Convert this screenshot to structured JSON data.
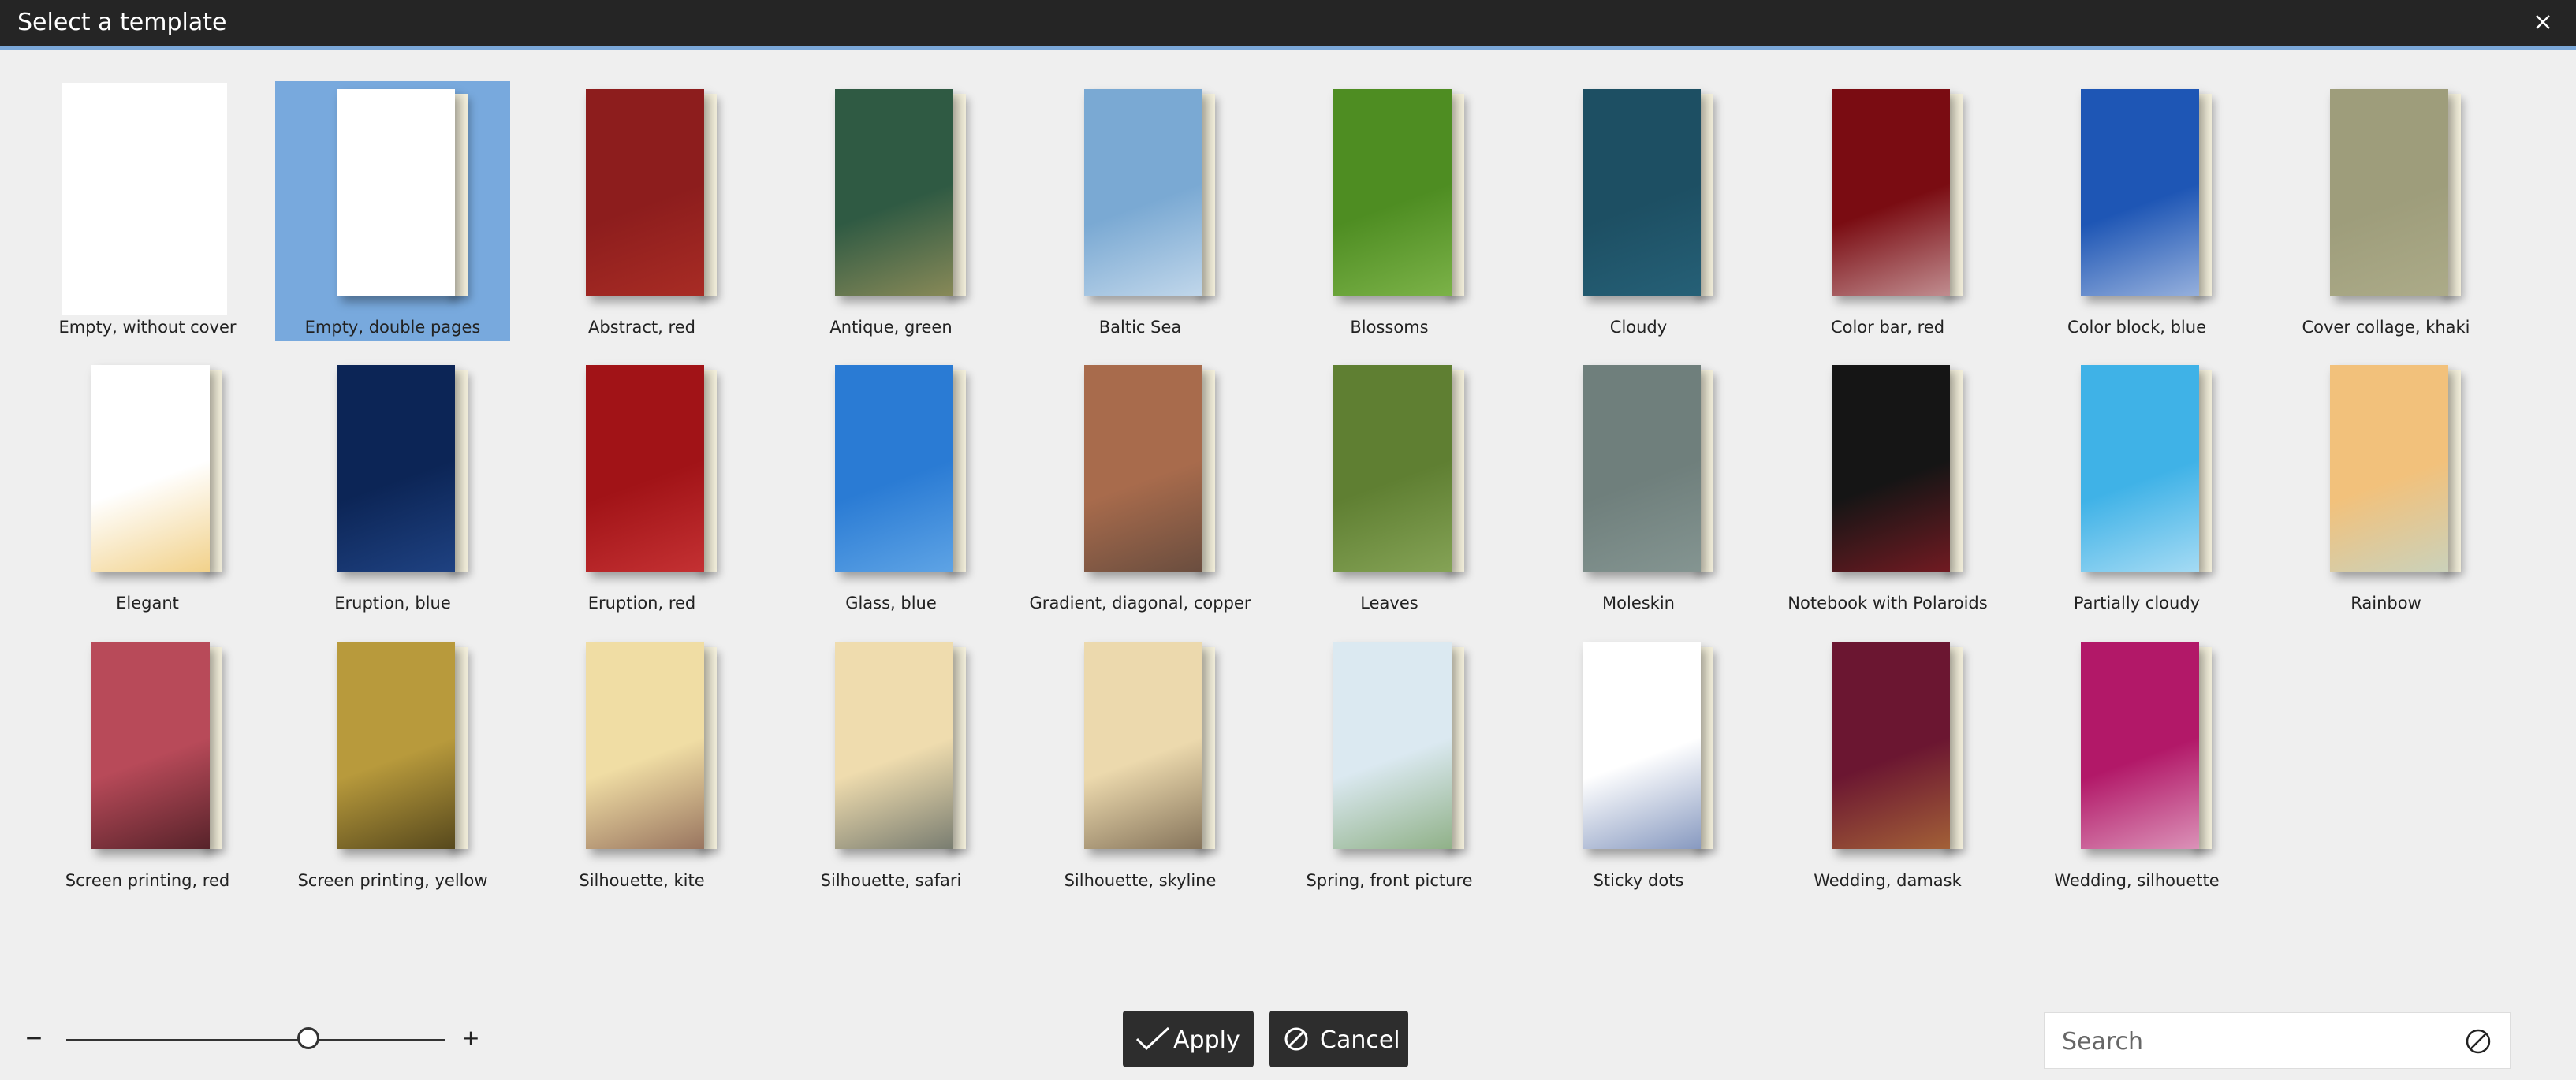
{
  "dialog": {
    "title": "Select a template"
  },
  "templates": [
    {
      "label": "Empty, without cover",
      "cover": "#ffffff",
      "accent": "#ffffff"
    },
    {
      "label": "Empty, double pages",
      "cover": "#ffffff",
      "accent": "#ffffff"
    },
    {
      "label": "Abstract, red",
      "cover": "#8d1d1d",
      "accent": "#c0392b"
    },
    {
      "label": "Antique, green",
      "cover": "#2f5a43",
      "accent": "#d7b36a"
    },
    {
      "label": "Baltic Sea",
      "cover": "#7aa9d3",
      "accent": "#ffffff"
    },
    {
      "label": "Blossoms",
      "cover": "#4e8d22",
      "accent": "#a4d36a"
    },
    {
      "label": "Cloudy",
      "cover": "#1d4f63",
      "accent": "#2d6f88"
    },
    {
      "label": "Color bar, red",
      "cover": "#7a0c12",
      "accent": "#ffffff"
    },
    {
      "label": "Color block, blue",
      "cover": "#1e56b5",
      "accent": "#ffffff"
    },
    {
      "label": "Cover collage, khaki",
      "cover": "#9e9d7b",
      "accent": "#b8b794"
    },
    {
      "label": "Elegant",
      "cover": "#ffffff",
      "accent": "#e6a923"
    },
    {
      "label": "Eruption, blue",
      "cover": "#0c2556",
      "accent": "#2f5ba8"
    },
    {
      "label": "Eruption, red",
      "cover": "#a11317",
      "accent": "#e34b4b"
    },
    {
      "label": "Glass, blue",
      "cover": "#2a7bd4",
      "accent": "#8cc7f4"
    },
    {
      "label": "Gradient, diagonal, copper",
      "cover": "#a86b4c",
      "accent": "#333333"
    },
    {
      "label": "Leaves",
      "cover": "#5f7f32",
      "accent": "#a6c275"
    },
    {
      "label": "Moleskin",
      "cover": "#6f7f7c",
      "accent": "#97a8a4"
    },
    {
      "label": "Notebook with Polaroids",
      "cover": "#151515",
      "accent": "#c21f2d"
    },
    {
      "label": "Partially cloudy",
      "cover": "#3fb2e7",
      "accent": "#ffffff"
    },
    {
      "label": "Rainbow",
      "cover": "#f2c17b",
      "accent": "#a7e0f2"
    },
    {
      "label": "Screen printing, red",
      "cover": "#b84a59",
      "accent": "#000000"
    },
    {
      "label": "Screen printing, yellow",
      "cover": "#b89a3c",
      "accent": "#000000"
    },
    {
      "label": "Silhouette, kite",
      "cover": "#f0dda4",
      "accent": "#4b1822"
    },
    {
      "label": "Silhouette, safari",
      "cover": "#efdcae",
      "accent": "#10283a"
    },
    {
      "label": "Silhouette, skyline",
      "cover": "#ecd9ad",
      "accent": "#2a1a12"
    },
    {
      "label": "Spring, front picture",
      "cover": "#dbe9f1",
      "accent": "#4d7f2a"
    },
    {
      "label": "Sticky dots",
      "cover": "#ffffff",
      "accent": "#1d3f88"
    },
    {
      "label": "Wedding, damask",
      "cover": "#6b1631",
      "accent": "#d4a33d"
    },
    {
      "label": "Wedding, silhouette",
      "cover": "#b21868",
      "accent": "#ffffff"
    }
  ],
  "footer": {
    "zoom_minus": "−",
    "zoom_plus": "+",
    "zoom_value": 0.64,
    "apply_label": "Apply",
    "cancel_label": "Cancel",
    "search_placeholder": "Search"
  },
  "colors": {
    "selected": "#78a9dd",
    "titlebar": "#252525",
    "accent_line": "#7aa7d8"
  }
}
